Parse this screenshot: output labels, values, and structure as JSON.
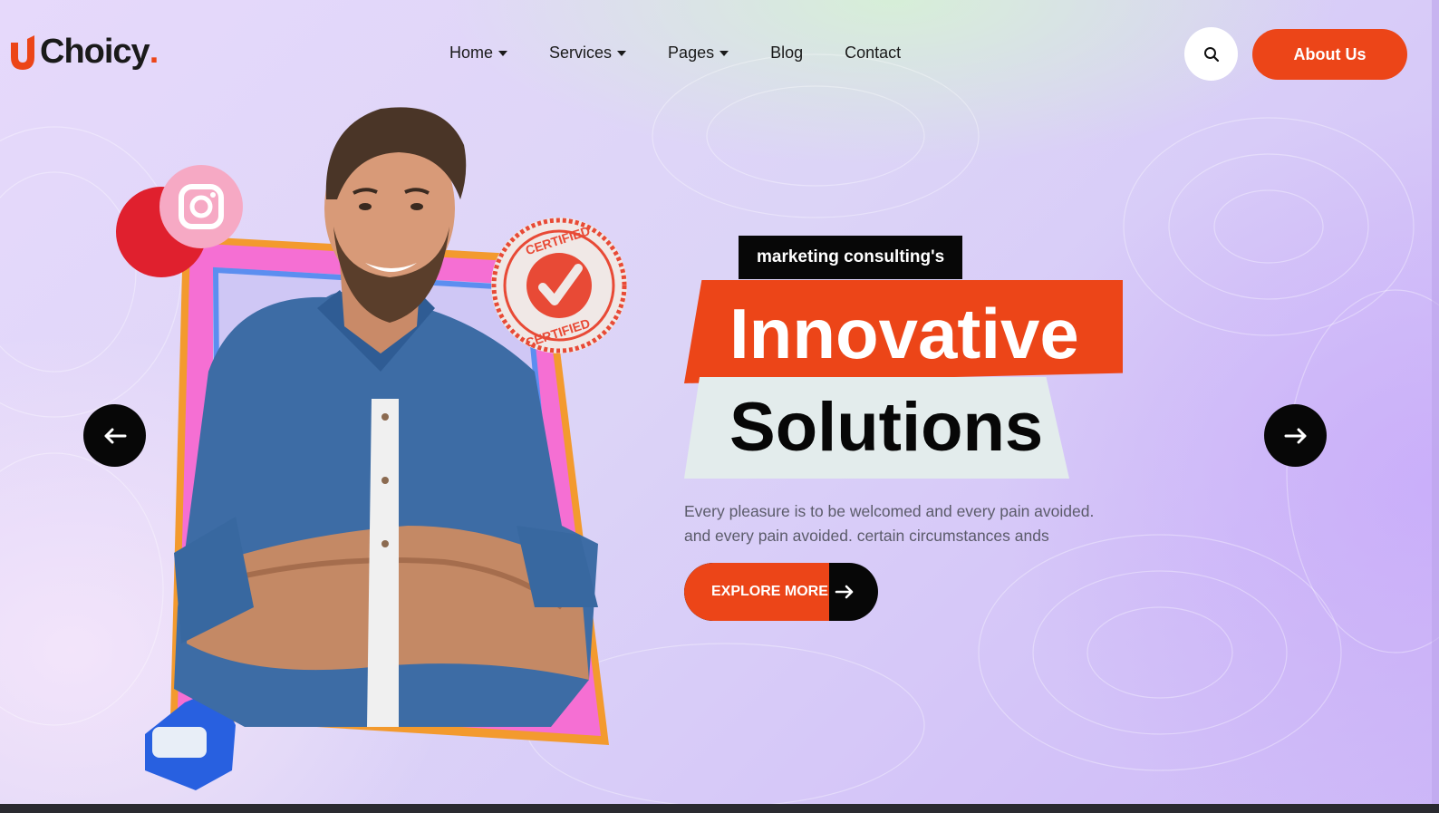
{
  "brand": {
    "name": "Choicy",
    "dot": ".",
    "accent": "#ec4518"
  },
  "nav": {
    "items": [
      {
        "label": "Home",
        "has_dropdown": true
      },
      {
        "label": "Services",
        "has_dropdown": true
      },
      {
        "label": "Pages",
        "has_dropdown": true
      },
      {
        "label": "Blog",
        "has_dropdown": false
      },
      {
        "label": "Contact",
        "has_dropdown": false
      }
    ]
  },
  "header": {
    "search_icon": "search-icon",
    "about_label": "About Us"
  },
  "hero": {
    "tag": "marketing consulting's",
    "title_line1": "Innovative",
    "title_line2": "Solutions",
    "description_line1": "Every pleasure is to be welcomed and every pain avoided.",
    "description_line2": "and every pain avoided. certain circumstances ands",
    "cta_label": "EXPLORE MORE",
    "badge_text": "CERTIFIED"
  },
  "slider": {
    "prev_icon": "arrow-left-icon",
    "next_icon": "arrow-right-icon"
  },
  "colors": {
    "accent": "#ec4518",
    "dark": "#070707",
    "light_panel": "#e3ecec",
    "text": "#5b5b6a"
  }
}
